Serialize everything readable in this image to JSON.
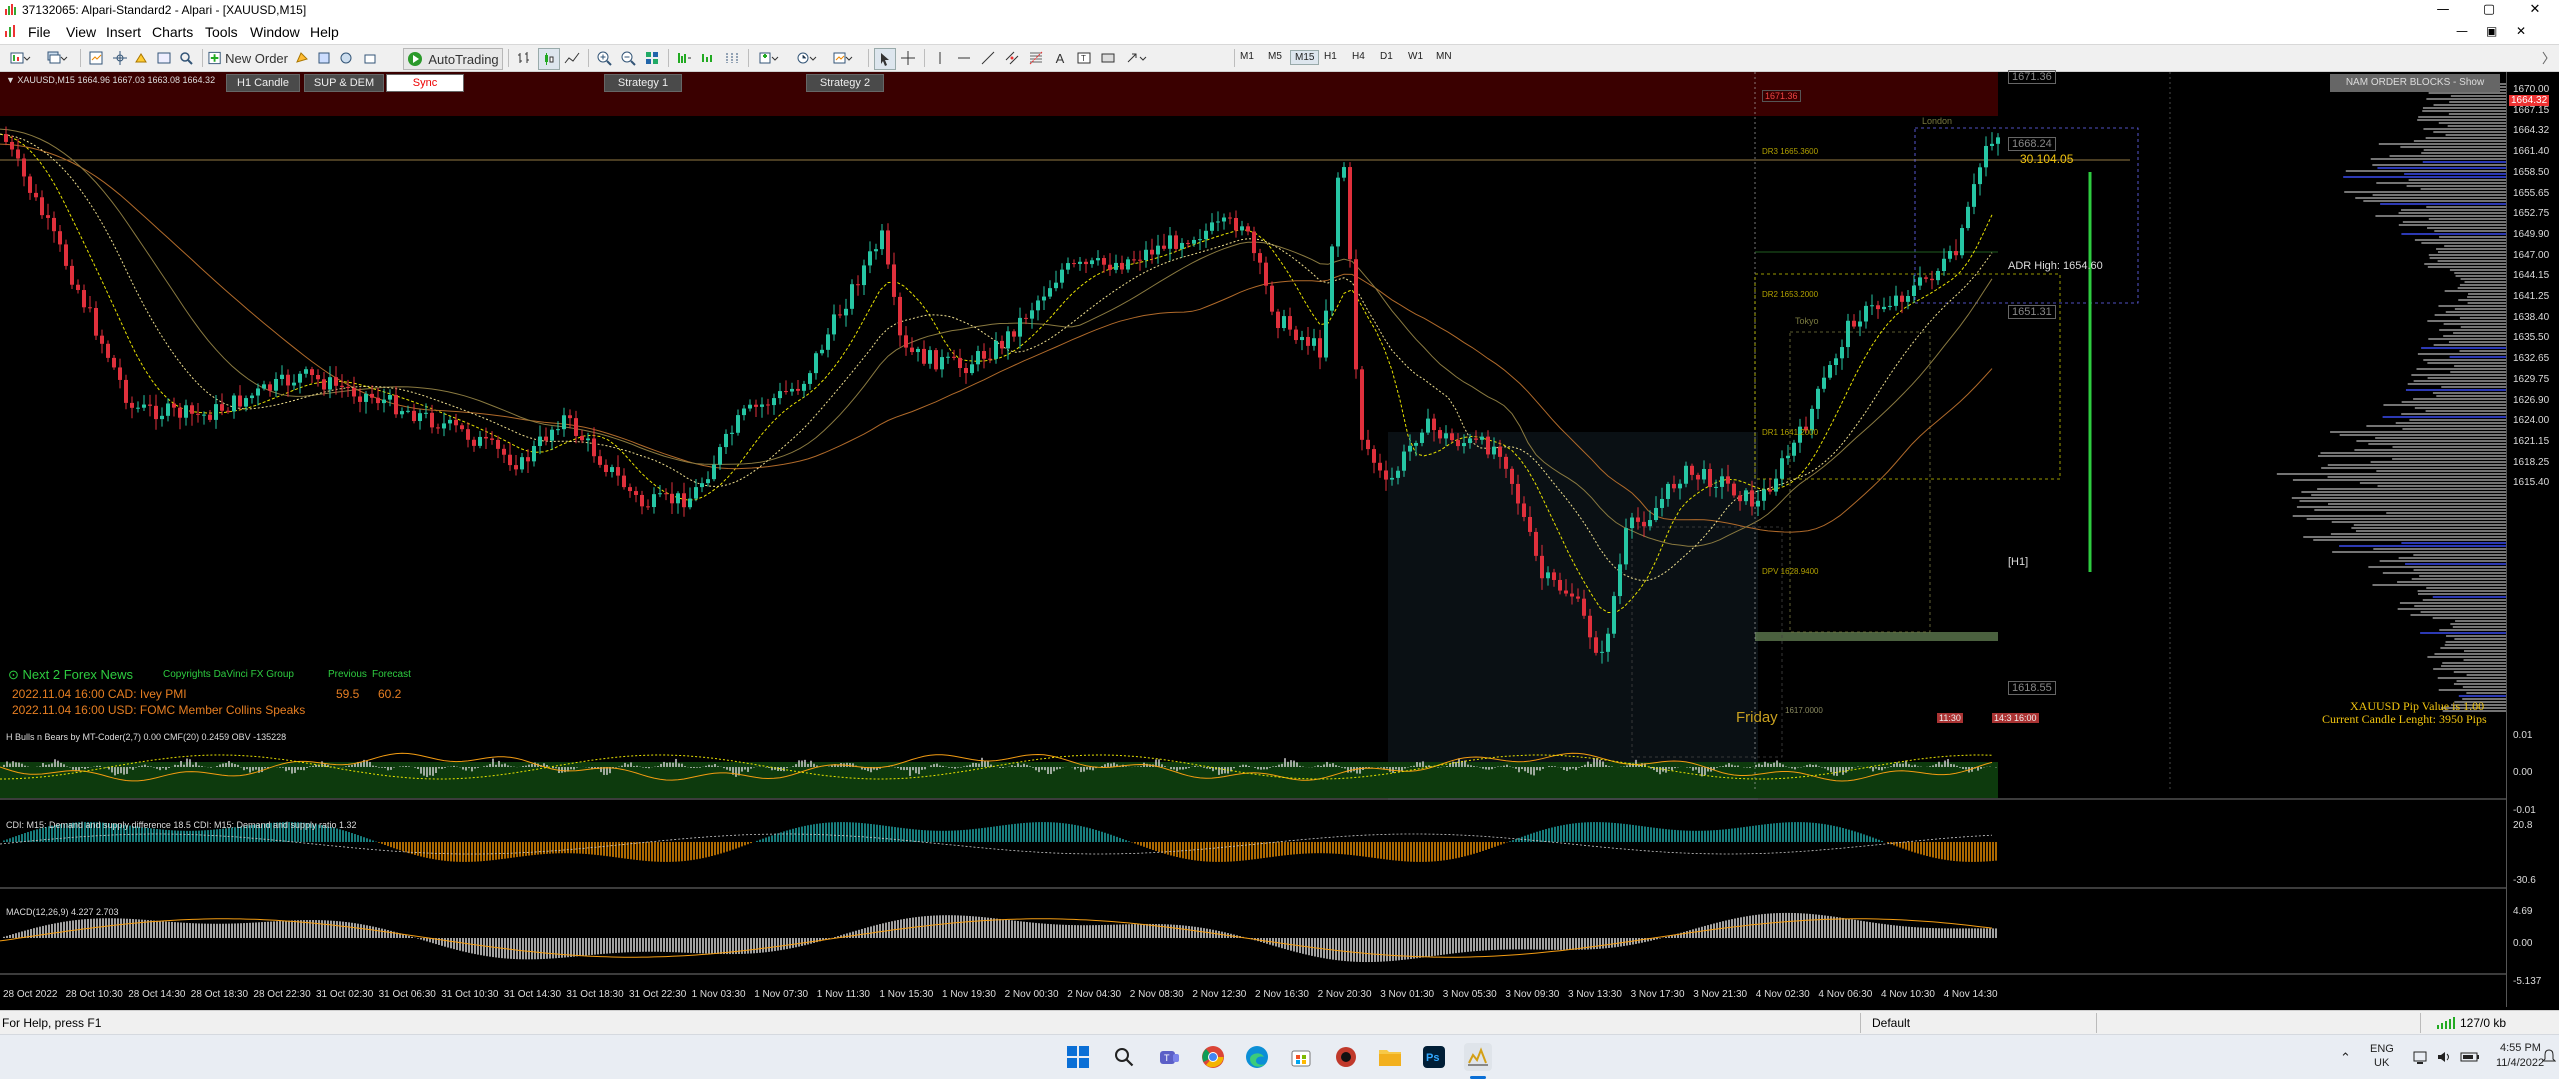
{
  "window": {
    "title": "37132065: Alpari-Standard2 - Alpari - [XAUUSD,M15]",
    "minimize_glyph": "—",
    "maximize_glyph": "▢",
    "close_glyph": "✕"
  },
  "menu": {
    "items": [
      "File",
      "View",
      "Insert",
      "Charts",
      "Tools",
      "Window",
      "Help"
    ],
    "mdi_controls": [
      "—",
      "▣",
      "✕"
    ]
  },
  "toolbar": {
    "new_order_label": "New Order",
    "autotrading_label": "AutoTrading",
    "timeframes": [
      "M1",
      "M5",
      "M15",
      "H1",
      "H4",
      "D1",
      "W1",
      "MN"
    ],
    "active_timeframe": "M15"
  },
  "chart": {
    "symbol_info": "XAUUSD,M15  1664.96 1667.03 1663.08 1664.32",
    "buttons": {
      "h1_candle": "H1 Candle",
      "sup_dem": "SUP & DEM",
      "sync": "Sync",
      "strategy1": "Strategy 1",
      "strategy2": "Strategy 2"
    },
    "nam_order_blocks": "NAM ORDER BLOCKS - Show",
    "zone_labels": {
      "dr3": "DR3 1665.3600",
      "dr2": "DR2 1653.2000",
      "dr1": "DR1 1641.2000",
      "dpv": "DPV 1628.9400",
      "bottom": "1617.0000",
      "london": "London",
      "tokyo": "Tokyo",
      "h1": "[H1]",
      "pips": "30.104.05",
      "adr_high": "ADR High: 1654.60",
      "friday": "Friday"
    },
    "boxed_prices": [
      "1671.36",
      "1668.24",
      "1651.31",
      "1618.55"
    ],
    "time_stamps": [
      "11:30",
      "14:30",
      "16:00"
    ],
    "pip_value": "XAUUSD Pip Value is 1.00",
    "candle_length": "Current Candle Lenght: 3950 Pips",
    "news": {
      "title": "Next 2 Forex News",
      "copyright": "Copyrights DaVinci FX Group",
      "col_previous": "Previous",
      "col_forecast": "Forecast",
      "items": [
        {
          "text": "2022.11.04 16:00   CAD: Ivey PMI",
          "previous": "59.5",
          "forecast": "60.2"
        },
        {
          "text": "2022.11.04 16:00   USD: FOMC Member Collins Speaks",
          "previous": "",
          "forecast": ""
        }
      ]
    },
    "price_labels": [
      "1670.00",
      "1667.15",
      "1664.32",
      "1661.40",
      "1658.50",
      "1655.65",
      "1652.75",
      "1649.90",
      "1647.00",
      "1644.15",
      "1641.25",
      "1638.40",
      "1635.50",
      "1632.65",
      "1629.75",
      "1626.90",
      "1624.00",
      "1621.15",
      "1618.25",
      "1615.40"
    ],
    "current_price": "1664.32",
    "indicators": [
      {
        "label": "H Bulls n Bears by MT-Coder(2,7) 0.00  CMF(20) 0.2459  OBV -135228",
        "axis": [
          "0.01",
          "0.00",
          "-0.01"
        ]
      },
      {
        "label": "CDI: M15: Demand and supply difference  18.5  CDI: M15: Demand and supply ratio  1.32",
        "axis": [
          "20.8",
          "-30.6"
        ]
      },
      {
        "label": "MACD(12,26,9) 4.227 2.703",
        "axis": [
          "4.69",
          "0.00",
          "-5.137"
        ]
      }
    ],
    "time_labels": [
      "28 Oct 2022",
      "28 Oct 10:30",
      "28 Oct 14:30",
      "28 Oct 18:30",
      "28 Oct 22:30",
      "31 Oct 02:30",
      "31 Oct 06:30",
      "31 Oct 10:30",
      "31 Oct 14:30",
      "31 Oct 18:30",
      "31 Oct 22:30",
      "1 Nov 03:30",
      "1 Nov 07:30",
      "1 Nov 11:30",
      "1 Nov 15:30",
      "1 Nov 19:30",
      "2 Nov 00:30",
      "2 Nov 04:30",
      "2 Nov 08:30",
      "2 Nov 12:30",
      "2 Nov 16:30",
      "2 Nov 20:30",
      "3 Nov 01:30",
      "3 Nov 05:30",
      "3 Nov 09:30",
      "3 Nov 13:30",
      "3 Nov 17:30",
      "3 Nov 21:30",
      "4 Nov 02:30",
      "4 Nov 06:30",
      "4 Nov 10:30",
      "4 Nov 14:30"
    ],
    "colors": {
      "bull": "#26c6a4",
      "bear": "#e0303c",
      "orange": "#f39c12",
      "yellow": "#e8e200",
      "green": "#2ecc40",
      "blue": "#3a4cf0"
    }
  },
  "status": {
    "help": "For Help, press F1",
    "profile": "Default",
    "traffic": "127/0 kb"
  },
  "taskbar": {
    "icons": [
      "windows-start-icon",
      "search-icon",
      "teams-icon",
      "chrome-icon",
      "edge-icon",
      "store-icon",
      "app-icon",
      "explorer-icon",
      "photoshop-icon",
      "metatrader-icon"
    ],
    "lang": "ENG",
    "region": "UK",
    "time": "4:55 PM",
    "date": "11/4/2022"
  }
}
